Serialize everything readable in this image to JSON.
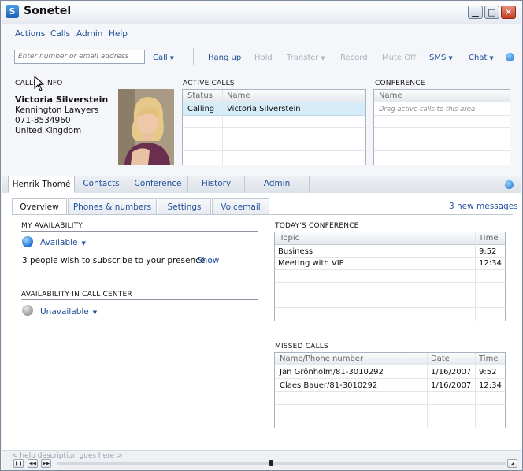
{
  "window": {
    "title": "Sonetel",
    "logo_letter": "S"
  },
  "menu": [
    "Actions",
    "Calls",
    "Admin",
    "Help"
  ],
  "toolbar": {
    "input_placeholder": "Enter number or email address",
    "call": "Call",
    "hang_up": "Hang up",
    "hold": "Hold",
    "transfer": "Transfer",
    "record": "Record",
    "mute_off": "Mute Off",
    "sms": "SMS",
    "chat": "Chat"
  },
  "callee": {
    "section_label": "CALLEE INFO",
    "name": "Victoria Silverstein",
    "company": "Kennington Lawyers",
    "phone": "071-8534960",
    "country": "United Kingdom"
  },
  "active_calls": {
    "label": "ACTIVE CALLS",
    "columns": [
      "Status",
      "Name"
    ],
    "rows": [
      {
        "status": "Calling",
        "name": "Victoria Silverstein"
      }
    ]
  },
  "conference": {
    "label": "CONFERENCE",
    "column": "Name",
    "hint": "Drag active calls to this area"
  },
  "main_tabs": [
    "Henrik Thomé",
    "Contacts",
    "Conference",
    "History",
    "Admin"
  ],
  "sub_tabs": [
    "Overview",
    "Phones & numbers",
    "Settings",
    "Voicemail"
  ],
  "messages_link": "3 new messages",
  "availability": {
    "label": "MY AVAILABILITY",
    "status": "Available",
    "subscribe_text": "3 people wish to subscribe to your presence",
    "show_link": "Show"
  },
  "call_center": {
    "label": "AVAILABILITY IN CALL CENTER",
    "status": "Unavailable"
  },
  "todays_conference": {
    "label": "TODAY'S CONFERENCE",
    "columns": [
      "Topic",
      "Time"
    ],
    "rows": [
      {
        "topic": "Business",
        "time": "9:52"
      },
      {
        "topic": "Meeting with VIP",
        "time": "12:34"
      }
    ]
  },
  "missed_calls": {
    "label": "MISSED CALLS",
    "columns": [
      "Name/Phone number",
      "Date",
      "Time"
    ],
    "rows": [
      {
        "name": "Jan Grönholm/81-3010292",
        "date": "1/16/2007",
        "time": "9:52"
      },
      {
        "name": "Claes Bauer/81-3010292",
        "date": "1/16/2007",
        "time": "12:34"
      }
    ]
  },
  "status_bar": {
    "help_text": "< help description goes here >"
  },
  "colors": {
    "link": "#1f4f9a",
    "selected_row": "#d6ecf8",
    "available": "#1f6fd0"
  }
}
